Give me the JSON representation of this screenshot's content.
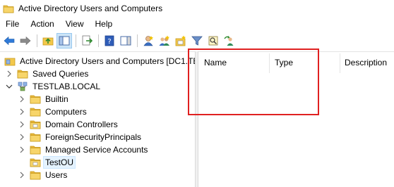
{
  "window": {
    "title": "Active Directory Users and Computers"
  },
  "menu": [
    "File",
    "Action",
    "View",
    "Help"
  ],
  "tree": {
    "root": "Active Directory Users and Computers [DC1.TES",
    "saved_queries": "Saved Queries",
    "domain": "TESTLAB.LOCAL",
    "children": [
      "Builtin",
      "Computers",
      "Domain Controllers",
      "ForeignSecurityPrincipals",
      "Managed Service Accounts",
      "TestOU",
      "Users"
    ],
    "selected": "TestOU"
  },
  "list": {
    "columns": [
      "Name",
      "Type",
      "Description"
    ]
  },
  "colors": {
    "annotation": "#e02020",
    "folder": "#f3c84b",
    "selection": "#e5f3ff"
  }
}
